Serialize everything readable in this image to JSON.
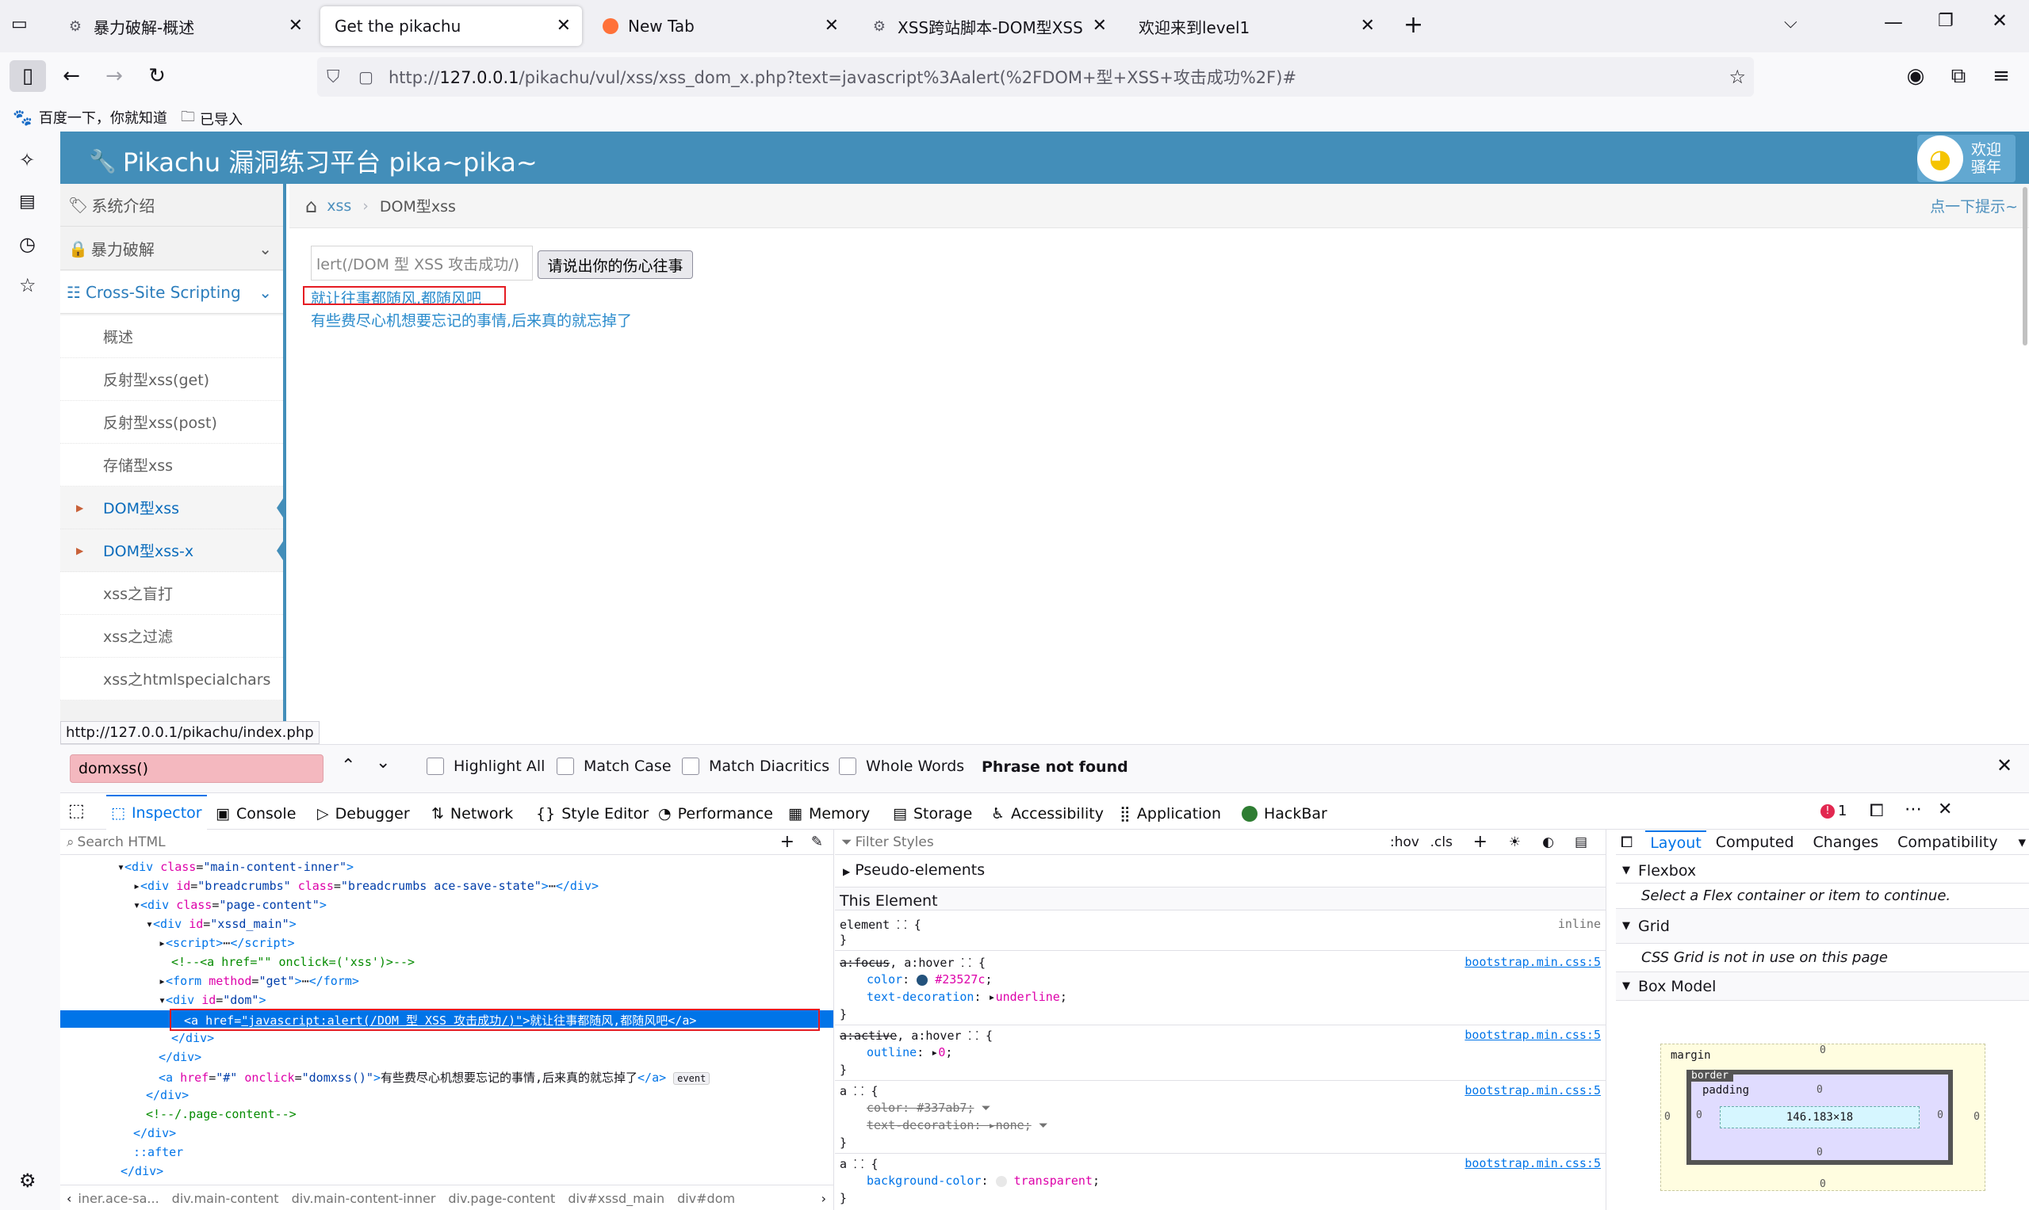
{
  "browser": {
    "tabs": [
      {
        "title": "暴力破解-概述"
      },
      {
        "title": "Get the pikachu"
      },
      {
        "title": "New Tab"
      },
      {
        "title": "XSS跨站脚本-DOM型XSS"
      },
      {
        "title": "欢迎来到level1"
      }
    ],
    "url_prefix": "http://",
    "url_host": "127.0.0.1",
    "url_rest": "/pikachu/vul/xss/xss_dom_x.php?text=javascript%3Aalert(%2FDOM+型+XSS+攻击成功%2F)#",
    "bookmarks": [
      "百度一下，你就知道",
      "已导入"
    ],
    "status_url": "http://127.0.0.1/pikachu/index.php"
  },
  "page": {
    "title": "Pikachu 漏洞练习平台 pika~pika~",
    "welcome_line1": "欢迎",
    "welcome_line2": "骚年",
    "breadcrumb_home": "xss",
    "breadcrumb_current": "DOM型xss",
    "hint": "点一下提示~",
    "nav": [
      {
        "label": "系统介绍"
      },
      {
        "label": "暴力破解"
      },
      {
        "label": "Cross-Site Scripting"
      }
    ],
    "subnav": [
      "概述",
      "反射型xss(get)",
      "反射型xss(post)",
      "存储型xss",
      "DOM型xss",
      "DOM型xss-x",
      "xss之盲打",
      "xss之过滤",
      "xss之htmlspecialchars"
    ],
    "input_value": "lert(/DOM 型 XSS 攻击成功/)",
    "submit_label": "请说出你的伤心往事",
    "link1": "就让往事都随风,都随风吧",
    "link2": "有些费尽心机想要忘记的事情,后来真的就忘掉了"
  },
  "findbar": {
    "query": "domxss()",
    "highlight_all": "Highlight All",
    "match_case": "Match Case",
    "match_diacritics": "Match Diacritics",
    "whole_words": "Whole Words",
    "status": "Phrase not found"
  },
  "devtools": {
    "tabs": [
      "Inspector",
      "Console",
      "Debugger",
      "Network",
      "Style Editor",
      "Performance",
      "Memory",
      "Storage",
      "Accessibility",
      "Application",
      "HackBar"
    ],
    "error_count": "1",
    "search_placeholder": "Search HTML",
    "filter_placeholder": "Filter Styles",
    "hov": ":hov",
    "cls": ".cls",
    "pseudo": "Pseudo-elements",
    "this_element": "This Element",
    "right_tabs": [
      "Layout",
      "Computed",
      "Changes",
      "Compatibility"
    ],
    "flexbox": "Flexbox",
    "flexbox_msg": "Select a Flex container or item to continue.",
    "grid": "Grid",
    "grid_msg": "CSS Grid is not in use on this page",
    "boxmodel": "Box Model",
    "box": {
      "margin": "margin",
      "border": "border",
      "padding": "padding",
      "size": "146.183×18",
      "zero": "0"
    },
    "breadcrumbs": [
      "iner.ace-sa...",
      "div.main-content",
      "div.main-content-inner",
      "div.page-content",
      "div#xssd_main",
      "div#dom"
    ],
    "css": {
      "element_label": "element",
      "inline": "inline",
      "src": "bootstrap.min.css:5",
      "color_val": "#23527c",
      "underline": "underline",
      "outline_val": "0",
      "strike_color": "#337ab7",
      "none": "none",
      "transparent": "transparent"
    },
    "event_badge": "event"
  },
  "colors": {
    "accent": "#438eb9",
    "link": "#2a8bcc",
    "highlight": "#0074e8"
  }
}
